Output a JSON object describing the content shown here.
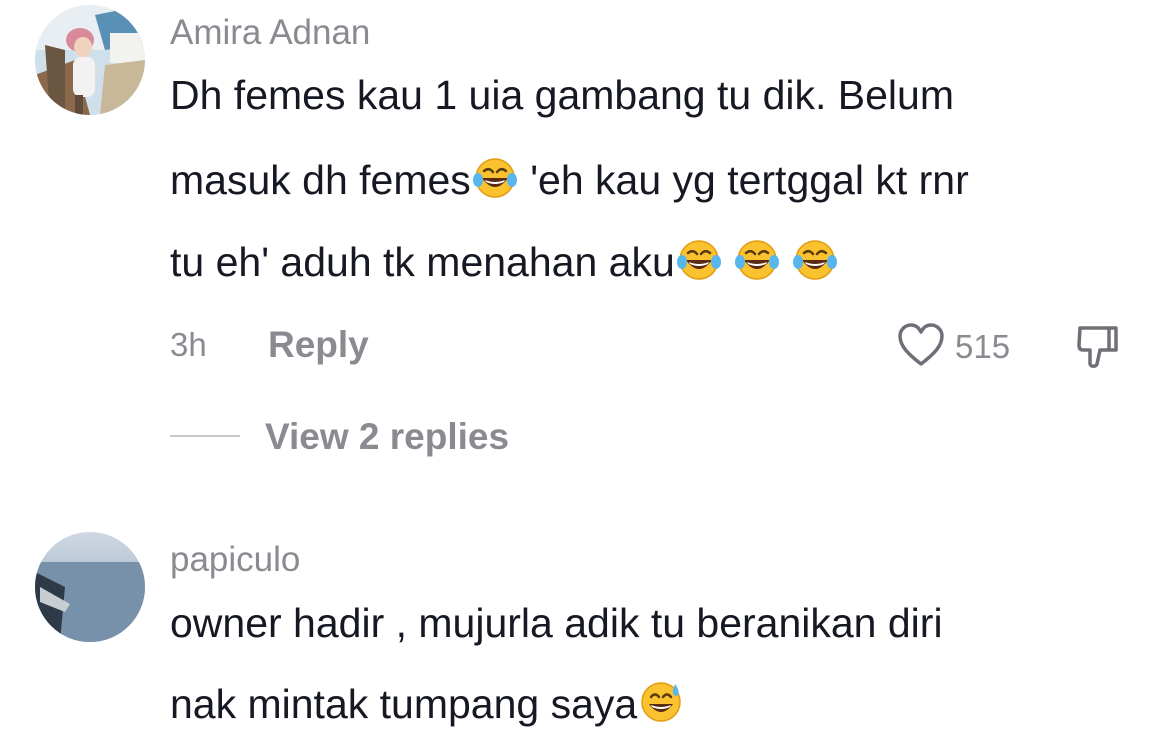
{
  "comments": [
    {
      "username": "Amira Adnan",
      "lines": [
        "Dh femes kau 1 uia gambang tu dik. Belum",
        "masuk dh femes",
        "'eh kau yg tertggal kt rnr",
        "tu eh' aduh tk menahan aku"
      ],
      "emojis": [
        "face-with-tears-of-joy",
        "face-with-tears-of-joy",
        "face-with-tears-of-joy",
        "face-with-tears-of-joy"
      ],
      "time": "3h",
      "reply_label": "Reply",
      "like_count": "515",
      "view_replies_label": "View 2 replies"
    },
    {
      "username": "papiculo",
      "lines": [
        "owner hadir , mujurla adik tu beranikan diri",
        "nak mintak tumpang saya"
      ],
      "emojis": [
        "grinning-face-with-sweat"
      ]
    }
  ],
  "icons": {
    "like": "heart-outline-icon",
    "dislike": "thumbs-down-icon"
  },
  "colors": {
    "primary_text": "#161823",
    "secondary_text": "#8a8b91",
    "divider": "#c7c8cc"
  }
}
